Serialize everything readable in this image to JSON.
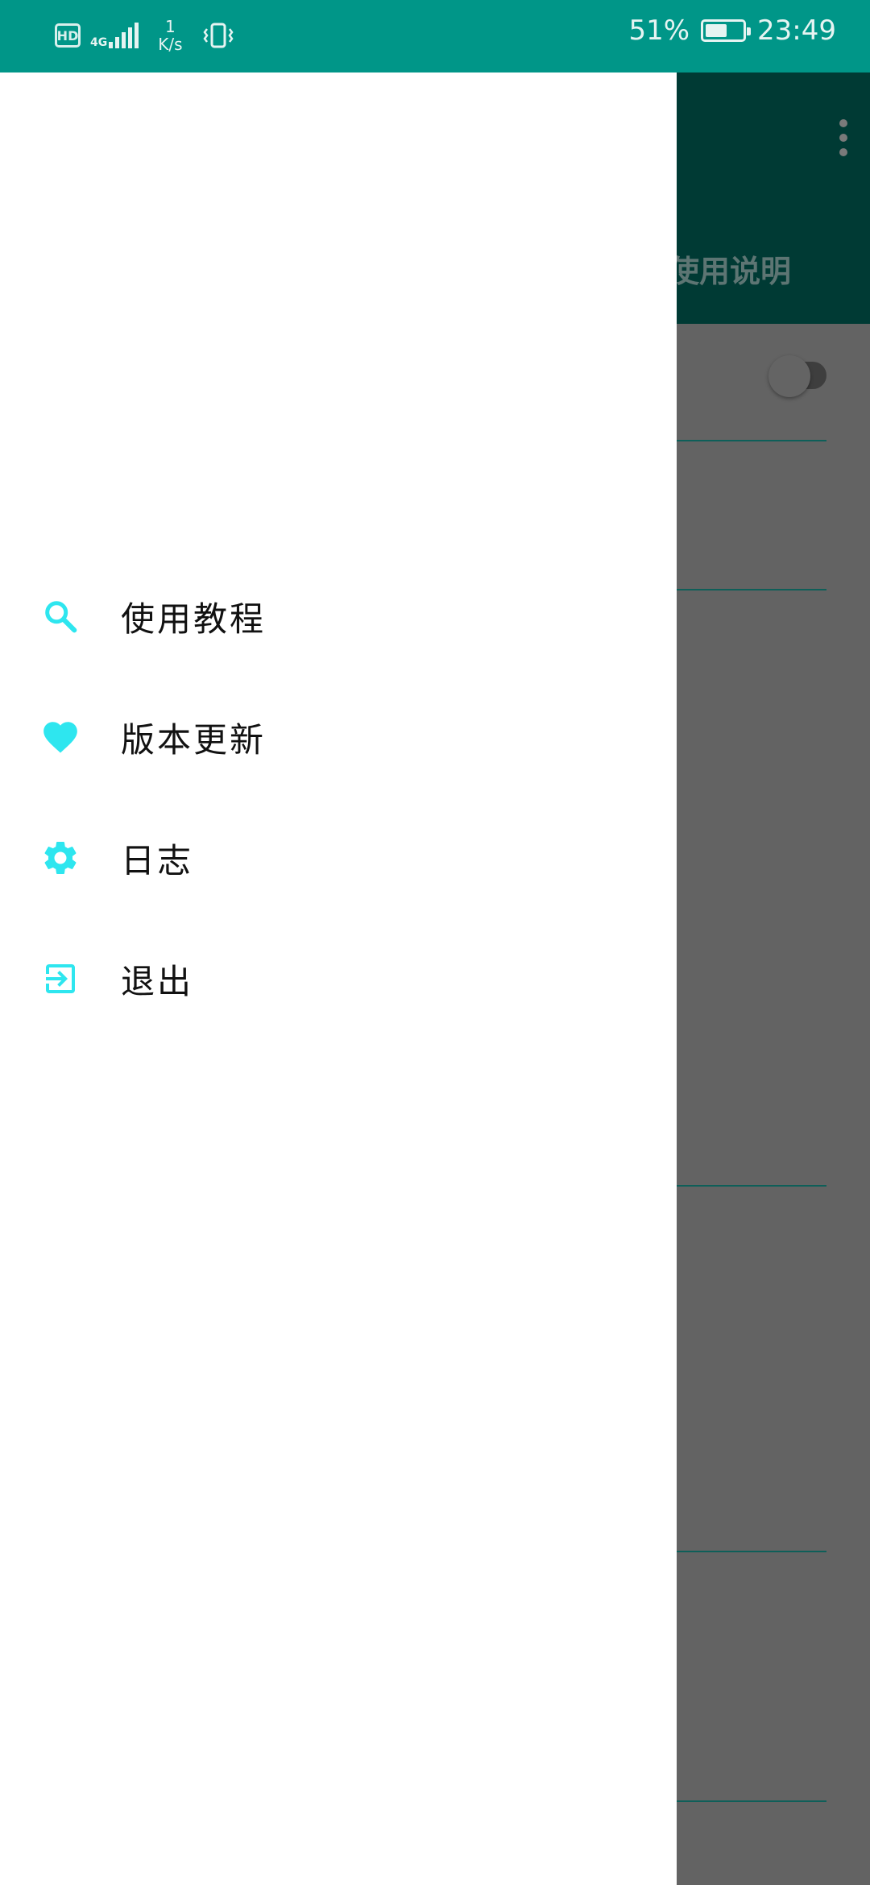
{
  "status_bar": {
    "hd": "HD",
    "network": "4G",
    "speed_value": "1",
    "speed_unit": "K/s",
    "battery_percent": "51%",
    "time": "23:49"
  },
  "background_app": {
    "tab_label": "使用说明"
  },
  "drawer": {
    "items": [
      {
        "label": "使用教程",
        "icon": "search-icon"
      },
      {
        "label": "版本更新",
        "icon": "heart-icon"
      },
      {
        "label": "日志",
        "icon": "gear-icon"
      },
      {
        "label": "退出",
        "icon": "exit-icon"
      }
    ],
    "accent_color": "#2ee6ef"
  }
}
